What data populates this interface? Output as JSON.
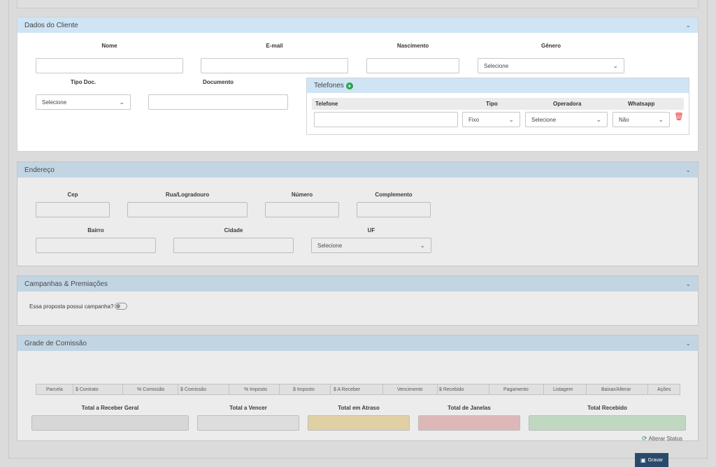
{
  "cliente": {
    "title": "Dados do Cliente",
    "labels": {
      "nome": "Nome",
      "email": "E-mail",
      "nascimento": "Nascimento",
      "genero": "Gênero",
      "tipo_doc": "Tipo Doc.",
      "documento": "Documento"
    },
    "genero_value": "Selecione",
    "tipo_doc_value": "Selecione"
  },
  "telefones": {
    "title": "Telefones",
    "columns": [
      "Telefone",
      "Tipo",
      "Operadora",
      "Whatsapp"
    ],
    "tipo_value": "Fixo",
    "operadora_value": "Selecione",
    "whatsapp_value": "Não"
  },
  "endereco": {
    "title": "Endereço",
    "labels": {
      "cep": "Cep",
      "rua": "Rua/Logradouro",
      "numero": "Número",
      "complemento": "Complemento",
      "bairro": "Bairro",
      "cidade": "Cidade",
      "uf": "UF"
    },
    "uf_value": "Selecione"
  },
  "campanhas": {
    "title": "Campanhas & Premiações",
    "question": "Essa proposta possui campanha?"
  },
  "grade": {
    "title": "Grade de Comissão",
    "columns": [
      "Parcela",
      "$ Contrato",
      "% Comissão",
      "$ Comissão",
      "% Imposto",
      "$ Imposto",
      "$ A Receber",
      "Vencimento",
      "$ Recebido",
      "Pagamento",
      "Listagem",
      "Baixar/Alterar",
      "Ações"
    ],
    "totals": [
      "Total a Receber Geral",
      "Total a Vencer",
      "Total em Atraso",
      "Total de Janelas",
      "Total Recebido"
    ],
    "alterar_status": "Alterar Status"
  },
  "gravar_label": "Gravar",
  "colors": {
    "accent_header": "#cfe5f5",
    "add_green": "#22a34a",
    "trash_red": "#e53935",
    "gravar_bg": "#2b4a6b"
  },
  "icons": [
    "chevron-down-icon",
    "plus-circle-icon",
    "trash-icon",
    "refresh-icon",
    "save-icon"
  ]
}
